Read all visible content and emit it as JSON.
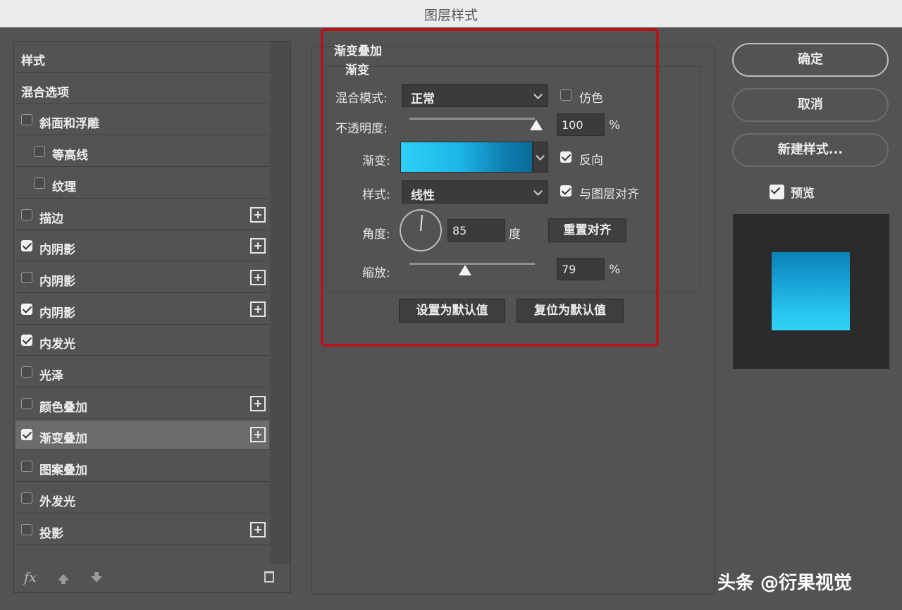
{
  "window": {
    "title": "图层样式"
  },
  "sidebar": {
    "items": [
      {
        "label": "样式",
        "checkbox": false,
        "checked": false,
        "plus": false,
        "selected": false
      },
      {
        "label": "混合选项",
        "checkbox": false,
        "checked": false,
        "plus": false,
        "selected": false
      },
      {
        "label": "斜面和浮雕",
        "checkbox": true,
        "checked": false,
        "plus": false,
        "selected": false
      },
      {
        "label": "等高线",
        "checkbox": true,
        "checked": false,
        "plus": false,
        "selected": false,
        "indent": true
      },
      {
        "label": "纹理",
        "checkbox": true,
        "checked": false,
        "plus": false,
        "selected": false,
        "indent": true
      },
      {
        "label": "描边",
        "checkbox": true,
        "checked": false,
        "plus": true,
        "selected": false
      },
      {
        "label": "内阴影",
        "checkbox": true,
        "checked": true,
        "plus": true,
        "selected": false
      },
      {
        "label": "内阴影",
        "checkbox": true,
        "checked": false,
        "plus": true,
        "selected": false
      },
      {
        "label": "内阴影",
        "checkbox": true,
        "checked": true,
        "plus": true,
        "selected": false
      },
      {
        "label": "内发光",
        "checkbox": true,
        "checked": true,
        "plus": false,
        "selected": false
      },
      {
        "label": "光泽",
        "checkbox": true,
        "checked": false,
        "plus": false,
        "selected": false
      },
      {
        "label": "颜色叠加",
        "checkbox": true,
        "checked": false,
        "plus": true,
        "selected": false
      },
      {
        "label": "渐变叠加",
        "checkbox": true,
        "checked": true,
        "plus": true,
        "selected": true
      },
      {
        "label": "图案叠加",
        "checkbox": true,
        "checked": false,
        "plus": false,
        "selected": false
      },
      {
        "label": "外发光",
        "checkbox": true,
        "checked": false,
        "plus": false,
        "selected": false
      },
      {
        "label": "投影",
        "checkbox": true,
        "checked": false,
        "plus": true,
        "selected": false
      }
    ],
    "fx_label": "fx"
  },
  "panel": {
    "section_title": "渐变叠加",
    "group_title": "渐变",
    "blend_mode": {
      "label": "混合模式:",
      "value": "正常"
    },
    "dither": {
      "label": "仿色",
      "checked": false
    },
    "opacity": {
      "label": "不透明度:",
      "value": "100",
      "unit": "%",
      "level": 1.0
    },
    "gradient": {
      "label": "渐变:",
      "colors": [
        "#2fd1f7",
        "#0a6a9a"
      ]
    },
    "reverse": {
      "label": "反向",
      "checked": true
    },
    "style": {
      "label": "样式:",
      "value": "线性"
    },
    "align": {
      "label": "与图层对齐",
      "checked": true
    },
    "angle": {
      "label": "角度:",
      "value": "85",
      "unit": "度"
    },
    "reset_align_button": "重置对齐",
    "scale": {
      "label": "缩放:",
      "value": "79",
      "unit": "%"
    },
    "set_default_button": "设置为默认值",
    "reset_default_button": "复位为默认值",
    "highlight_color": "#b4151d"
  },
  "actions": {
    "ok": "确定",
    "cancel": "取消",
    "new_style": "新建样式...",
    "preview": {
      "label": "预览",
      "checked": true
    }
  },
  "watermark": "头条 @衍果视觉"
}
